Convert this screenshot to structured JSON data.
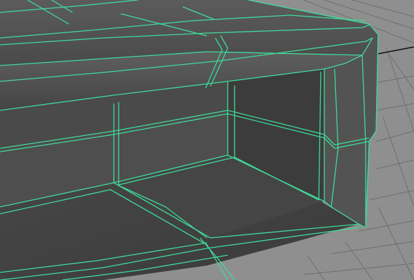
{
  "viewport": {
    "background_color": "#8f8f8f",
    "grid_color": "#6e6e6e",
    "axis_line_color": "#111111",
    "wireframe_color": "#3fdc9d",
    "shading": {
      "top_light": "#595959",
      "top_mid": "#4b4b4b",
      "side": "#555555",
      "inner_face": "#3d3d3d",
      "inner_floor": "#444444",
      "bottom_front": "#3a3a3a"
    }
  },
  "model": {
    "object_type": "polygon-mesh",
    "selection_state": "wireframe-on-shaded",
    "visible_parts": [
      "top-slab",
      "bevel-edge",
      "inner-cavity",
      "side-leg",
      "base"
    ]
  }
}
